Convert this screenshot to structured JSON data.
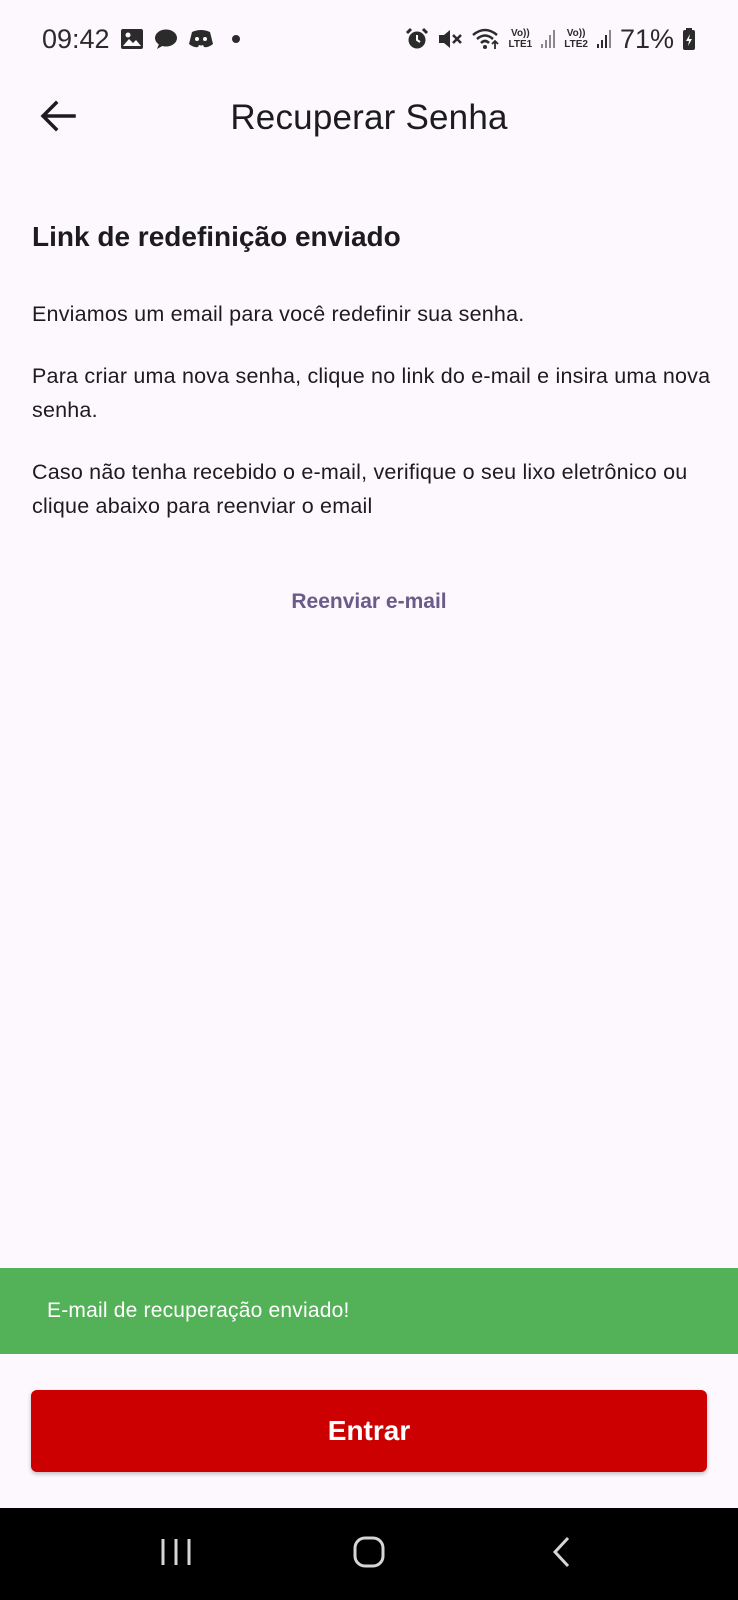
{
  "status_bar": {
    "time": "09:42",
    "battery": "71%",
    "left_icons": [
      "gallery-icon",
      "chat-icon",
      "discord-icon",
      "notification-dot"
    ],
    "right_icons": [
      "alarm-icon",
      "mute-icon",
      "wifi-icon",
      "volte-lte1-icon",
      "signal-icon",
      "volte-lte2-icon",
      "signal-icon",
      "battery-icon"
    ],
    "volte1_top": "Vo))",
    "volte1_bottom": "LTE1",
    "volte2_top": "Vo))",
    "volte2_bottom": "LTE2"
  },
  "app_bar": {
    "title": "Recuperar Senha",
    "back_icon": "arrow-left-icon"
  },
  "content": {
    "heading": "Link de redefinição enviado",
    "paragraphs": [
      "Enviamos um email para você redefinir sua senha.",
      "Para criar uma nova senha, clique no link do e-mail e insira uma nova senha.",
      "Caso não tenha recebido o e-mail, verifique o seu lixo eletrônico ou clique abaixo para reenviar o email"
    ],
    "resend_label": "Reenviar e-mail"
  },
  "snackbar": {
    "message": "E-mail de recuperação enviado!",
    "color": "#53b158"
  },
  "primary_button": {
    "label": "Entrar",
    "color": "#cc0000"
  },
  "nav_bar": {
    "buttons": [
      "recents-icon",
      "home-icon",
      "back-icon"
    ]
  },
  "colors": {
    "background": "#fdf8fd",
    "link": "#6b5b8a"
  }
}
